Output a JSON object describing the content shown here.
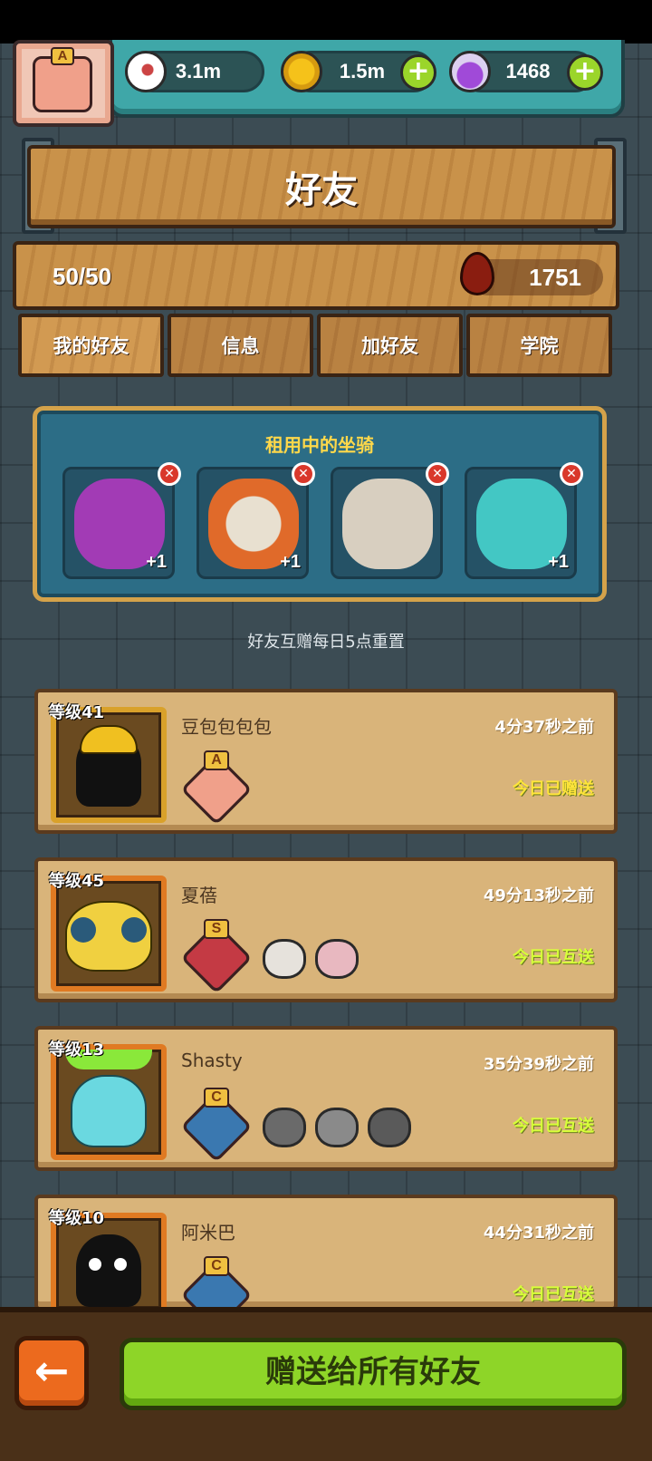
{
  "resources": [
    {
      "icon": "eyeball-icon",
      "value": "3.1m",
      "has_plus": false
    },
    {
      "icon": "gold-coin-icon",
      "value": "1.5m",
      "has_plus": true
    },
    {
      "icon": "potion-icon",
      "value": "1468",
      "has_plus": true
    }
  ],
  "player": {
    "rank": "A"
  },
  "page": {
    "title": "好友"
  },
  "summary": {
    "friend_count": "50/50",
    "blood": "1751"
  },
  "tabs": [
    {
      "label": "我的好友",
      "active": true
    },
    {
      "label": "信息",
      "active": false
    },
    {
      "label": "加好友",
      "active": false
    },
    {
      "label": "学院",
      "active": false
    }
  ],
  "rental": {
    "title": "租用中的坐骑",
    "mounts": [
      {
        "name": "purple-monster-mount",
        "bonus": "+1",
        "color": "#a23bb5"
      },
      {
        "name": "lion-dancer-mount",
        "bonus": "+1",
        "color": "#e8e0d0"
      },
      {
        "name": "rabbit-mount",
        "bonus": "",
        "color": "#d8cfc0"
      },
      {
        "name": "teal-blob-mount",
        "bonus": "+1",
        "color": "#43c7c4"
      }
    ]
  },
  "reset_note": "好友互赠每日5点重置",
  "friends": [
    {
      "level": "等级41",
      "name": "豆包包包包",
      "time": "4分37秒之前",
      "status": "今日已赠送",
      "rank": "A"
    },
    {
      "level": "等级45",
      "name": "夏蓓",
      "time": "49分13秒之前",
      "status": "今日已互送",
      "rank": "S"
    },
    {
      "level": "等级13",
      "name": "Shasty",
      "time": "35分39秒之前",
      "status": "今日已互送",
      "rank": "C"
    },
    {
      "level": "等级10",
      "name": "阿米巴",
      "time": "44分31秒之前",
      "status": "今日已互送",
      "rank": "C"
    }
  ],
  "footer": {
    "back_icon": "arrow-left-icon",
    "gift_all_label": "赠送给所有好友"
  },
  "colors": {
    "accent_green": "#8ed528",
    "status_lime": "#d8ff3a",
    "status_yellow": "#ffe53a",
    "gold_text": "#ffd84a"
  }
}
